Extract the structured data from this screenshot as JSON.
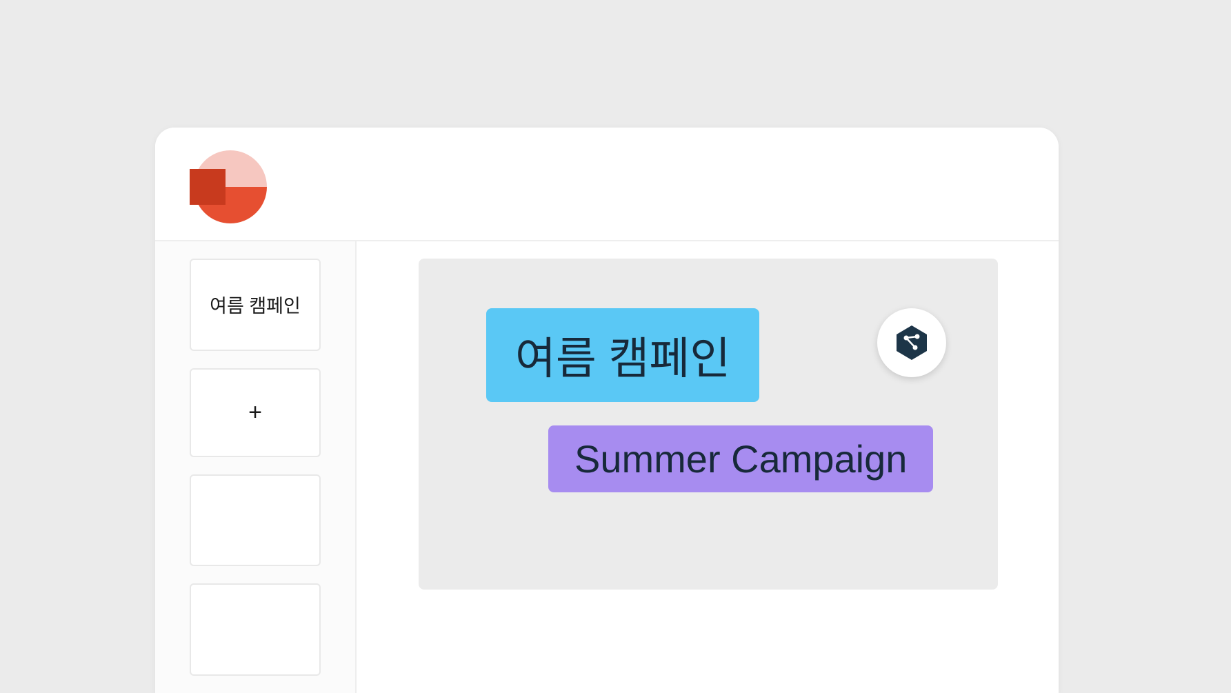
{
  "sidebar": {
    "slides": [
      {
        "label": "여름 캠페인"
      }
    ],
    "add_label": "+"
  },
  "canvas": {
    "korean_title": "여름 캠페인",
    "english_title": "Summer Campaign"
  }
}
